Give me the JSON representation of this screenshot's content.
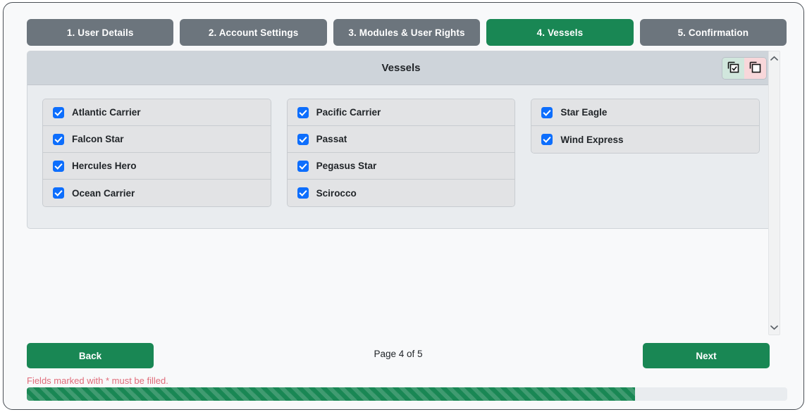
{
  "wizard": {
    "tabs": [
      {
        "label": "1. User Details",
        "active": false
      },
      {
        "label": "2. Account Settings",
        "active": false
      },
      {
        "label": "3. Modules & User Rights",
        "active": false
      },
      {
        "label": "4. Vessels",
        "active": true
      },
      {
        "label": "5. Confirmation",
        "active": false
      }
    ]
  },
  "panel": {
    "title": "Vessels",
    "bulk_actions": {
      "select_all": {
        "icon": "select-all-icon",
        "background": "#d1e7dd"
      },
      "deselect_all": {
        "icon": "deselect-all-icon",
        "background": "#f8d7da"
      }
    }
  },
  "vessel_columns": [
    {
      "items": [
        {
          "label": "Atlantic Carrier",
          "checked": true
        },
        {
          "label": "Falcon Star",
          "checked": true
        },
        {
          "label": "Hercules Hero",
          "checked": true
        },
        {
          "label": "Ocean Carrier",
          "checked": true
        }
      ]
    },
    {
      "items": [
        {
          "label": "Pacific Carrier",
          "checked": true
        },
        {
          "label": "Passat",
          "checked": true
        },
        {
          "label": "Pegasus Star",
          "checked": true
        },
        {
          "label": "Scirocco",
          "checked": true
        }
      ]
    },
    {
      "items": [
        {
          "label": "Star Eagle",
          "checked": true
        },
        {
          "label": "Wind Express",
          "checked": true
        }
      ]
    }
  ],
  "scrollbar": {
    "up_icon": "chevron-up-icon",
    "down_icon": "chevron-down-icon"
  },
  "footer": {
    "back_label": "Back",
    "next_label": "Next",
    "page_indicator": "Page 4 of 5",
    "validation_message": "Fields marked with * must be filled.",
    "progress_percent": 80
  },
  "colors": {
    "accent_green": "#198754",
    "tab_inactive": "#6c757d",
    "checkbox_blue": "#0d6efd",
    "error_red": "#e06c7a"
  }
}
